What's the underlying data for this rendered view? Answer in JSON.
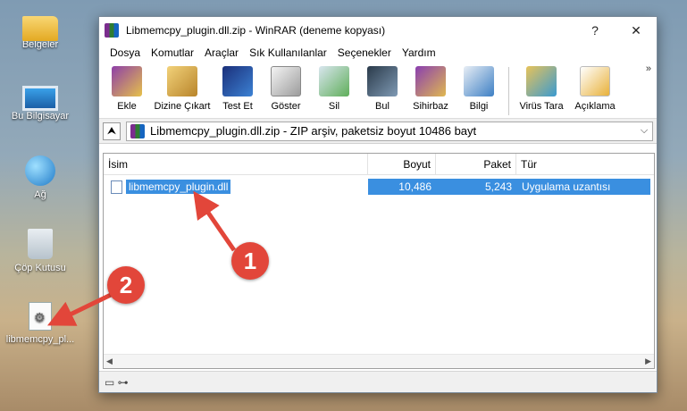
{
  "desktop": {
    "icons": [
      {
        "label": "Belgeler",
        "icon": "documents-folder-icon"
      },
      {
        "label": "Bu Bilgisayar",
        "icon": "this-pc-icon"
      },
      {
        "label": "Ağ",
        "icon": "network-icon"
      },
      {
        "label": "Çöp Kutusu",
        "icon": "recycle-bin-icon"
      },
      {
        "label": "libmemcpy_pl...",
        "icon": "dll-file-icon"
      }
    ]
  },
  "window": {
    "title": "Libmemcpy_plugin.dll.zip - WinRAR (deneme kopyası)",
    "help_label": "?",
    "close_label": "✕",
    "menu": [
      "Dosya",
      "Komutlar",
      "Araçlar",
      "Sık Kullanılanlar",
      "Seçenekler",
      "Yardım"
    ],
    "toolbar": [
      {
        "label": "Ekle",
        "icon": "add-archive-icon",
        "color": "#8e3fa8"
      },
      {
        "label": "Dizine Çıkart",
        "icon": "extract-to-icon",
        "color": "#d9a441"
      },
      {
        "label": "Test Et",
        "icon": "test-icon",
        "color": "#2f64b8"
      },
      {
        "label": "Göster",
        "icon": "view-icon",
        "color": "#cfcfcf"
      },
      {
        "label": "Sil",
        "icon": "delete-icon",
        "color": "#5fae5a"
      },
      {
        "label": "Bul",
        "icon": "find-icon",
        "color": "#4a6b8a"
      },
      {
        "label": "Sihirbaz",
        "icon": "wizard-icon",
        "color": "#8a3fb0"
      },
      {
        "label": "Bilgi",
        "icon": "info-icon",
        "color": "#3d7fc4"
      },
      {
        "label": "Virüs Tara",
        "icon": "virus-scan-icon",
        "color": "#3a9ad0"
      },
      {
        "label": "Açıklama",
        "icon": "comment-icon",
        "color": "#e8b13a"
      }
    ],
    "toolbar_more": "»",
    "address": "Libmemcpy_plugin.dll.zip - ZIP arşiv, paketsiz boyut 10486 bayt",
    "up_label": "⮝",
    "columns": {
      "name": "İsim",
      "size": "Boyut",
      "packed": "Paket",
      "type": "Tür"
    },
    "files": [
      {
        "name": "libmemcpy_plugin.dll",
        "size": "10,486",
        "packed": "5,243",
        "type": "Uygulama uzantısı"
      }
    ],
    "status": "▭ ⊶"
  },
  "callouts": [
    "1",
    "2"
  ],
  "colors": {
    "selection": "#3a8fe0",
    "callout": "#e2463a"
  }
}
